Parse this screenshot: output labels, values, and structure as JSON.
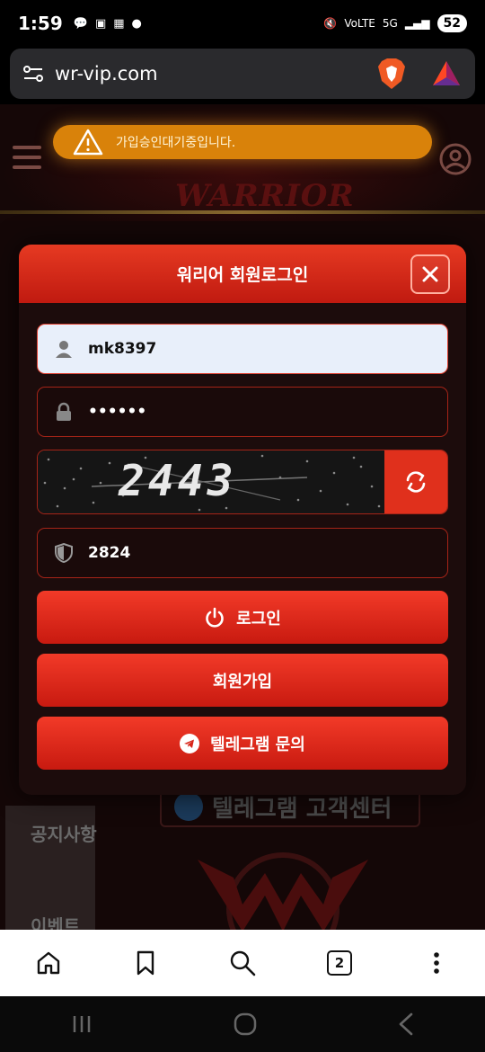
{
  "status_bar": {
    "time": "1:59",
    "battery": "52",
    "network": "5G"
  },
  "browser": {
    "url": "wr-vip.com",
    "tab_count": "2"
  },
  "toast": {
    "message": "가입승인대기중입니다."
  },
  "background": {
    "logo": "WARRIOR",
    "side_items": [
      "공지사항",
      "이벤트"
    ],
    "telegram_banner": "텔레그램 고객센터"
  },
  "modal": {
    "title": "워리어 회원로그인",
    "username": "mk8397",
    "password_masked": "••••••",
    "captcha_text": "2443",
    "captcha_input": "2824",
    "login_label": "로그인",
    "signup_label": "회원가입",
    "telegram_label": "텔레그램 문의"
  },
  "colors": {
    "accent": "#e0301c",
    "toast": "#d9820a",
    "modal_bg": "#1c0c0c"
  }
}
